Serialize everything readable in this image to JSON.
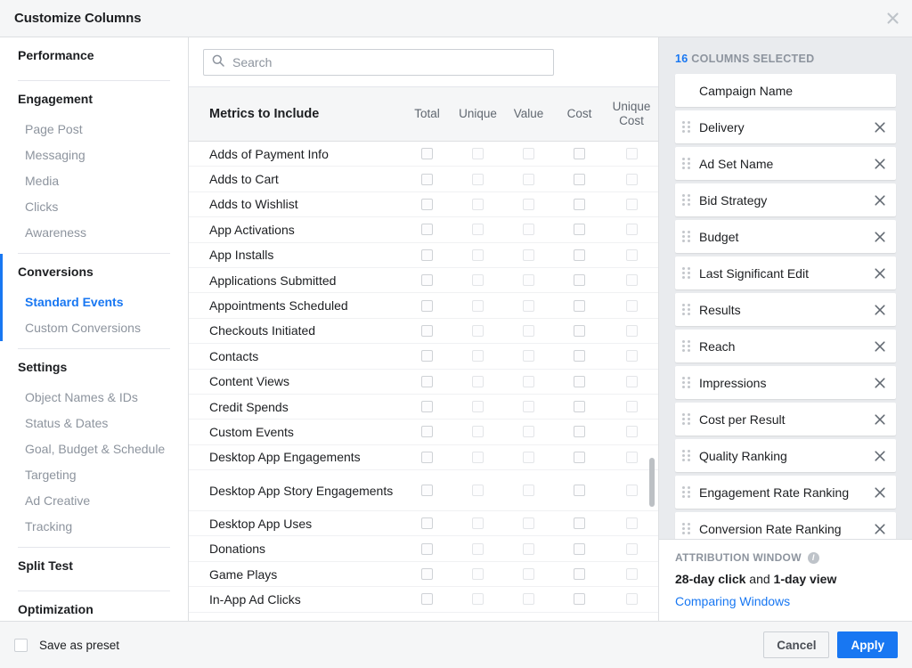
{
  "dialog": {
    "title": "Customize Columns",
    "close_icon": "close-icon"
  },
  "sidebar": {
    "groups": [
      {
        "label": "Performance",
        "active": false,
        "items": []
      },
      {
        "label": "Engagement",
        "active": false,
        "items": [
          {
            "label": "Page Post",
            "selected": false
          },
          {
            "label": "Messaging",
            "selected": false
          },
          {
            "label": "Media",
            "selected": false
          },
          {
            "label": "Clicks",
            "selected": false
          },
          {
            "label": "Awareness",
            "selected": false
          }
        ]
      },
      {
        "label": "Conversions",
        "active": true,
        "items": [
          {
            "label": "Standard Events",
            "selected": true
          },
          {
            "label": "Custom Conversions",
            "selected": false
          }
        ]
      },
      {
        "label": "Settings",
        "active": false,
        "items": [
          {
            "label": "Object Names & IDs",
            "selected": false
          },
          {
            "label": "Status & Dates",
            "selected": false
          },
          {
            "label": "Goal, Budget & Schedule",
            "selected": false
          },
          {
            "label": "Targeting",
            "selected": false
          },
          {
            "label": "Ad Creative",
            "selected": false
          },
          {
            "label": "Tracking",
            "selected": false
          }
        ]
      },
      {
        "label": "Split Test",
        "active": false,
        "items": []
      },
      {
        "label": "Optimization",
        "active": false,
        "items": []
      }
    ]
  },
  "search": {
    "placeholder": "Search",
    "value": "",
    "icon": "search-icon"
  },
  "metrics_table": {
    "name_header": "Metrics to Include",
    "column_headers": [
      "Total",
      "Unique",
      "Value",
      "Cost",
      "Unique Cost"
    ],
    "rows": [
      {
        "label": "Adds of Payment Info",
        "checks": [
          false,
          false,
          false,
          false,
          false
        ]
      },
      {
        "label": "Adds to Cart",
        "checks": [
          false,
          false,
          false,
          false,
          false
        ]
      },
      {
        "label": "Adds to Wishlist",
        "checks": [
          false,
          false,
          false,
          false,
          false
        ]
      },
      {
        "label": "App Activations",
        "checks": [
          false,
          false,
          false,
          false,
          false
        ]
      },
      {
        "label": "App Installs",
        "checks": [
          false,
          false,
          false,
          false,
          false
        ]
      },
      {
        "label": "Applications Submitted",
        "checks": [
          false,
          false,
          false,
          false,
          false
        ]
      },
      {
        "label": "Appointments Scheduled",
        "checks": [
          false,
          false,
          false,
          false,
          false
        ]
      },
      {
        "label": "Checkouts Initiated",
        "checks": [
          false,
          false,
          false,
          false,
          false
        ]
      },
      {
        "label": "Contacts",
        "checks": [
          false,
          false,
          false,
          false,
          false
        ]
      },
      {
        "label": "Content Views",
        "checks": [
          false,
          false,
          false,
          false,
          false
        ]
      },
      {
        "label": "Credit Spends",
        "checks": [
          false,
          false,
          false,
          false,
          false
        ]
      },
      {
        "label": "Custom Events",
        "checks": [
          false,
          false,
          false,
          false,
          false
        ]
      },
      {
        "label": "Desktop App Engagements",
        "checks": [
          false,
          false,
          false,
          false,
          false
        ]
      },
      {
        "label": "Desktop App Story Engagements",
        "checks": [
          false,
          false,
          false,
          false,
          false
        ]
      },
      {
        "label": "Desktop App Uses",
        "checks": [
          false,
          false,
          false,
          false,
          false
        ]
      },
      {
        "label": "Donations",
        "checks": [
          false,
          false,
          false,
          false,
          false
        ]
      },
      {
        "label": "Game Plays",
        "checks": [
          false,
          false,
          false,
          false,
          false
        ]
      },
      {
        "label": "In-App Ad Clicks",
        "checks": [
          false,
          false,
          false,
          false,
          false
        ]
      }
    ]
  },
  "selected_panel": {
    "count": "16",
    "header_suffix": "COLUMNS SELECTED",
    "items": [
      {
        "label": "Campaign Name",
        "removable": false,
        "draggable": false
      },
      {
        "label": "Delivery",
        "removable": true,
        "draggable": true
      },
      {
        "label": "Ad Set Name",
        "removable": true,
        "draggable": true
      },
      {
        "label": "Bid Strategy",
        "removable": true,
        "draggable": true
      },
      {
        "label": "Budget",
        "removable": true,
        "draggable": true
      },
      {
        "label": "Last Significant Edit",
        "removable": true,
        "draggable": true
      },
      {
        "label": "Results",
        "removable": true,
        "draggable": true
      },
      {
        "label": "Reach",
        "removable": true,
        "draggable": true
      },
      {
        "label": "Impressions",
        "removable": true,
        "draggable": true
      },
      {
        "label": "Cost per Result",
        "removable": true,
        "draggable": true
      },
      {
        "label": "Quality Ranking",
        "removable": true,
        "draggable": true
      },
      {
        "label": "Engagement Rate Ranking",
        "removable": true,
        "draggable": true
      },
      {
        "label": "Conversion Rate Ranking",
        "removable": true,
        "draggable": true
      }
    ]
  },
  "attribution": {
    "header": "Attribution Window",
    "info_icon": "info-icon",
    "value_click": "28-day click",
    "value_conj": " and ",
    "value_view": "1-day view",
    "link": "Comparing Windows"
  },
  "footer": {
    "save_preset_label": "Save as preset",
    "cancel_label": "Cancel",
    "apply_label": "Apply"
  },
  "colors": {
    "accent": "#1877f2",
    "panel_bg": "#e9ebee",
    "header_bg": "#f5f6f7",
    "muted_text": "#8d949e"
  }
}
